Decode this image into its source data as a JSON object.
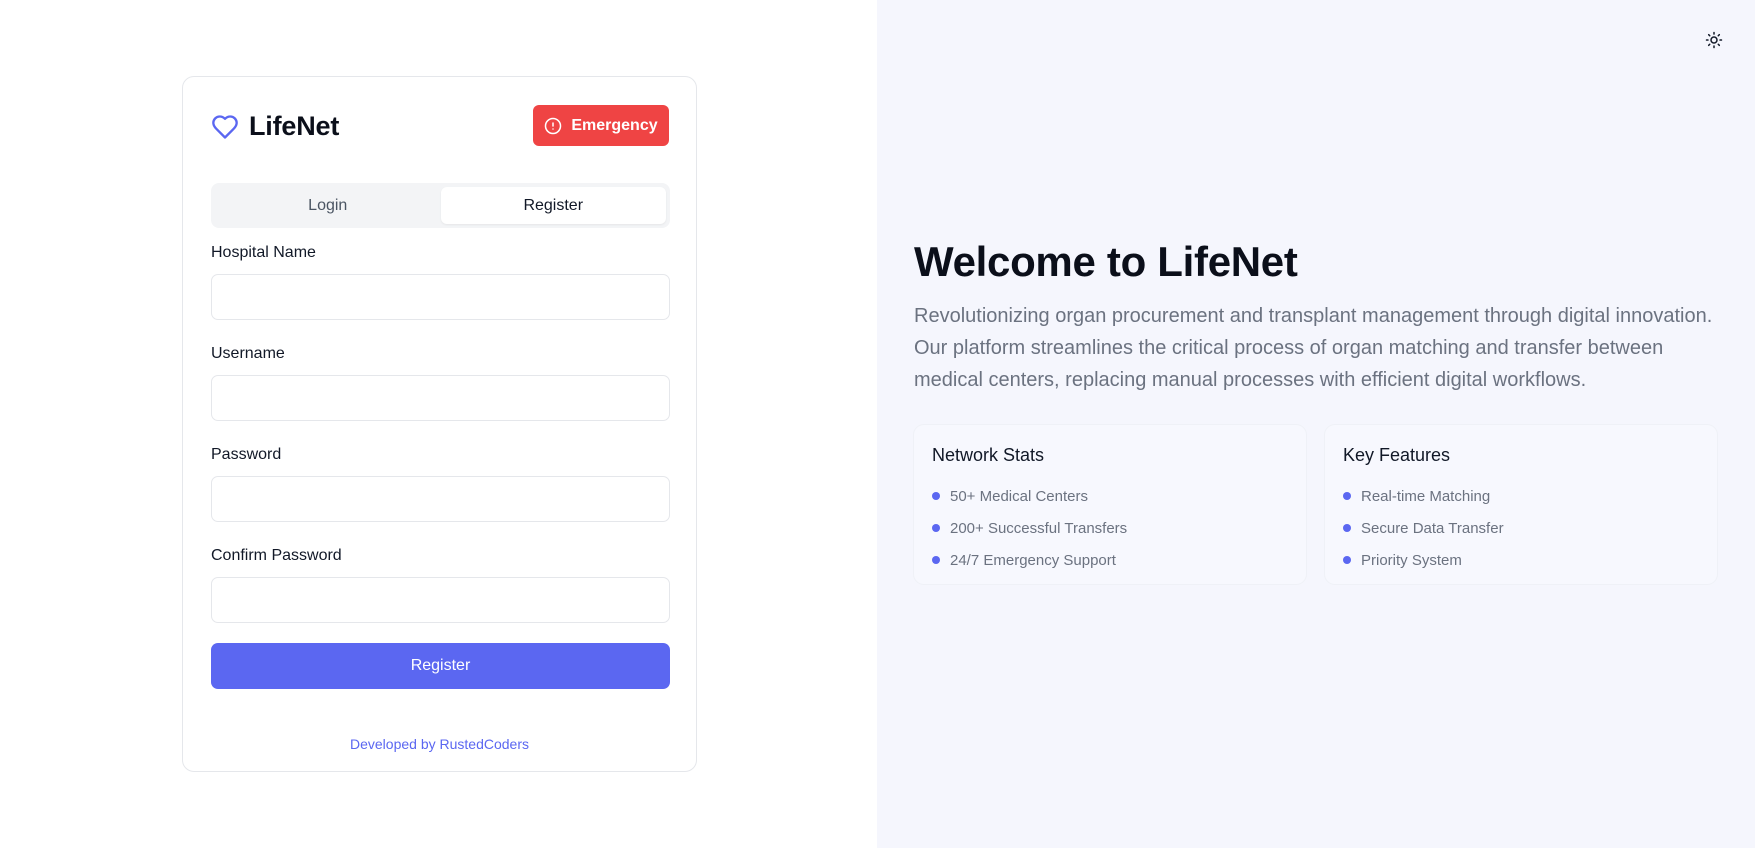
{
  "brand": {
    "name": "LifeNet",
    "icon": "heart-icon"
  },
  "emergency": {
    "label": "Emergency",
    "icon": "alert-circle-icon",
    "color": "#ef4444"
  },
  "auth": {
    "tabs": [
      {
        "label": "Login",
        "active": false
      },
      {
        "label": "Register",
        "active": true
      }
    ],
    "fields": [
      {
        "label": "Hospital Name",
        "value": "",
        "placeholder": ""
      },
      {
        "label": "Username",
        "value": "",
        "placeholder": ""
      },
      {
        "label": "Password",
        "value": "",
        "placeholder": ""
      },
      {
        "label": "Confirm Password",
        "value": "",
        "placeholder": ""
      }
    ],
    "submit_label": "Register",
    "credit": "Developed by RustedCoders"
  },
  "theme_toggle": {
    "icon": "sun-icon"
  },
  "hero": {
    "title": "Welcome to LifeNet",
    "description": "Revolutionizing organ procurement and transplant management through digital innovation. Our platform streamlines the critical process of organ matching and transfer between medical centers, replacing manual processes with efficient digital workflows."
  },
  "network_stats": {
    "title": "Network Stats",
    "items": [
      "50+ Medical Centers",
      "200+ Successful Transfers",
      "24/7 Emergency Support"
    ]
  },
  "key_features": {
    "title": "Key Features",
    "items": [
      "Real-time Matching",
      "Secure Data Transfer",
      "Priority System"
    ]
  },
  "colors": {
    "accent": "#5b67f1",
    "danger": "#ef4444",
    "right_panel_bg": "#f5f6fd",
    "muted_text": "#6b7280"
  }
}
